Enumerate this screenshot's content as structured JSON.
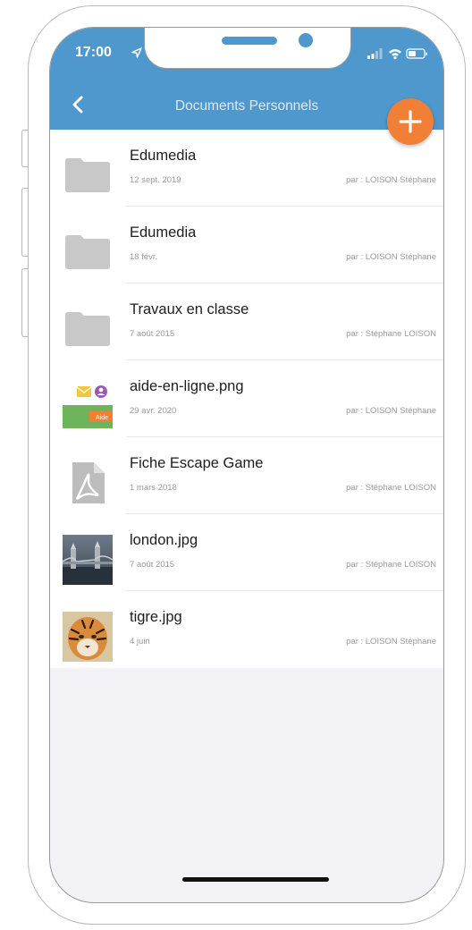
{
  "status_bar": {
    "time": "17:00"
  },
  "header": {
    "title": "Documents Personnels"
  },
  "colors": {
    "header": "#4f98cd",
    "fab": "#f17f35"
  },
  "documents": [
    {
      "name": "Edumedia",
      "date": "12 sept. 2019",
      "author": "par : LOISON Stéphane",
      "icon": "folder-icon"
    },
    {
      "name": "Edumedia",
      "date": "18 févr.",
      "author": "par : LOISON Stéphane",
      "icon": "folder-icon"
    },
    {
      "name": "Travaux en classe",
      "date": "7 août 2015",
      "author": "par : Stéphane LOISON",
      "icon": "folder-icon"
    },
    {
      "name": "aide-en-ligne.png",
      "date": "29 avr. 2020",
      "author": "par : LOISON Stéphane",
      "icon": "image-thumbnail"
    },
    {
      "name": "Fiche Escape Game",
      "date": "1 mars 2018",
      "author": "par : Stéphane LOISON",
      "icon": "pdf-icon"
    },
    {
      "name": "london.jpg",
      "date": "7 août 2015",
      "author": "par : Stéphane LOISON",
      "icon": "image-thumbnail"
    },
    {
      "name": "tigre.jpg",
      "date": "4 juin",
      "author": "par : LOISON Stéphane",
      "icon": "image-thumbnail"
    }
  ],
  "thumbnail_text": {
    "aide": "Aide"
  }
}
